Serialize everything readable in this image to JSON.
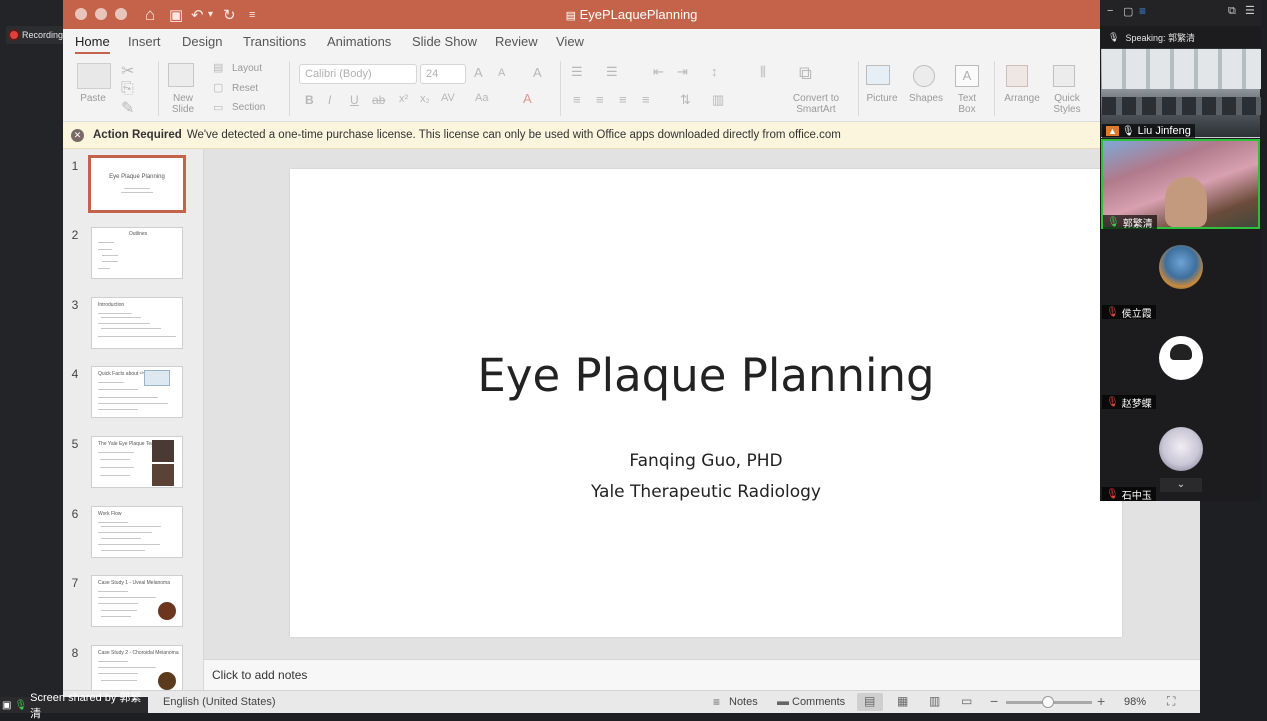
{
  "recording": {
    "label": "Recording"
  },
  "window": {
    "title": "EyePLaquePlanning",
    "tabs": [
      "Home",
      "Insert",
      "Design",
      "Transitions",
      "Animations",
      "Slide Show",
      "Review",
      "View"
    ],
    "active_tab": "Home"
  },
  "ribbon": {
    "paste": "Paste",
    "new_slide": "New\nSlide",
    "layout": "Layout",
    "reset": "Reset",
    "section": "Section",
    "font_name": "Calibri (Body)",
    "font_size": "24",
    "convert_smartart": "Convert to\nSmartArt",
    "picture": "Picture",
    "shapes": "Shapes",
    "text_box": "Text\nBox",
    "arrange": "Arrange",
    "quick_styles": "Quick\nStyles"
  },
  "message_bar": {
    "title": "Action Required",
    "text": "We've detected a one-time purchase license. This license can only be used with Office apps downloaded directly from office.com"
  },
  "thumbnails": [
    {
      "num": "1",
      "title": "Eye Plaque Planning"
    },
    {
      "num": "2",
      "title": "Outlines"
    },
    {
      "num": "3",
      "title": "Introduction"
    },
    {
      "num": "4",
      "title": "Quick Facts about ¹²⁵I"
    },
    {
      "num": "5",
      "title": "The Yale Eye Plaque Team"
    },
    {
      "num": "6",
      "title": "Work Flow"
    },
    {
      "num": "7",
      "title": "Case Study 1 - Uveal Melanoma"
    },
    {
      "num": "8",
      "title": "Case Study 2 - Choroidal Melanoma"
    }
  ],
  "slide": {
    "title": "Eye Plaque Planning",
    "author": "Fanqing Guo, PHD",
    "affiliation": "Yale Therapeutic Radiology"
  },
  "notes": {
    "placeholder": "Click to add notes"
  },
  "status": {
    "language": "English (United States)",
    "notes": "Notes",
    "comments": "Comments",
    "zoom": "98%"
  },
  "zoom_panel": {
    "speaking": "Speaking: 郭繁清",
    "participants": [
      "Liu Jinfeng",
      "郭繁清",
      "侯立霞",
      "赵梦蝶",
      "石中玉"
    ],
    "screen_shared_by": "Screen shared by 郭繁清"
  }
}
